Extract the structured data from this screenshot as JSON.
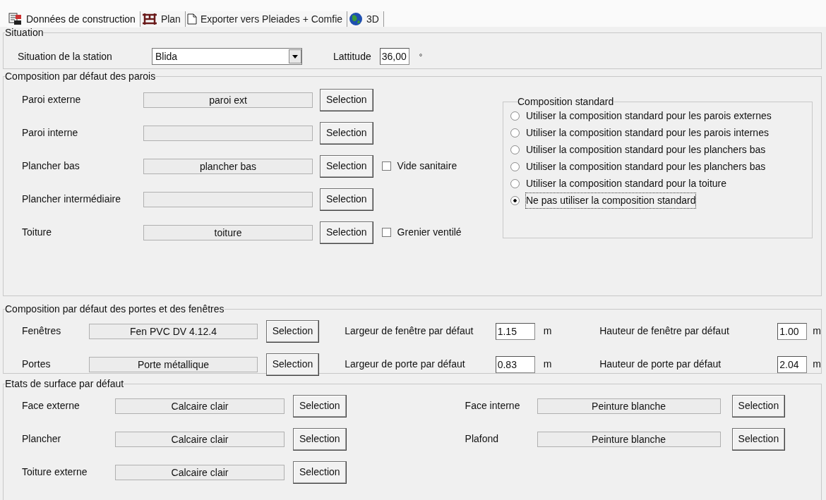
{
  "tabs": [
    {
      "label": "Données de construction",
      "selected": true
    },
    {
      "label": "Plan",
      "selected": false
    },
    {
      "label": "Exporter vers Pleiades + Comfie",
      "selected": false
    },
    {
      "label": "3D",
      "selected": false
    }
  ],
  "situation": {
    "legend": "Situation",
    "station_label": "Situation de la station",
    "station_value": "Blida",
    "latitude_label": "Lattitude",
    "latitude_value": "36,00",
    "latitude_unit": "°"
  },
  "walls": {
    "legend": "Composition par défaut des parois",
    "rows": [
      {
        "label": "Paroi externe",
        "value": "paroi ext",
        "button": "Selection"
      },
      {
        "label": "Paroi interne",
        "value": "",
        "button": "Selection"
      },
      {
        "label": "Plancher bas",
        "value": "plancher bas",
        "button": "Selection",
        "checkbox": {
          "label": "Vide sanitaire",
          "checked": false
        }
      },
      {
        "label": "Plancher intermédiaire",
        "value": "",
        "button": "Selection"
      },
      {
        "label": "Toiture",
        "value": "toiture",
        "button": "Selection",
        "checkbox": {
          "label": "Grenier ventilé",
          "checked": false
        }
      }
    ],
    "standard": {
      "legend": "Composition standard",
      "options": [
        {
          "label": "Utiliser la composition standard pour les parois externes",
          "selected": false
        },
        {
          "label": "Utiliser la composition standard pour les parois internes",
          "selected": false
        },
        {
          "label": "Utiliser la composition standard pour les planchers bas",
          "selected": false
        },
        {
          "label": "Utiliser la composition standard pour les planchers bas",
          "selected": false
        },
        {
          "label": "Utiliser la composition standard pour la toiture",
          "selected": false
        },
        {
          "label": "Ne pas utiliser la composition standard",
          "selected": true
        }
      ]
    }
  },
  "openings": {
    "legend": "Composition par défaut des portes et des fenêtres",
    "rows": [
      {
        "label": "Fenêtres",
        "value": "Fen PVC DV 4.12.4",
        "button": "Selection",
        "width_label": "Largeur de fenêtre par défaut",
        "width_value": "1.15",
        "width_unit": "m",
        "height_label": "Hauteur de fenêtre par défaut",
        "height_value": "1.00",
        "height_unit": "m"
      },
      {
        "label": "Portes",
        "value": "Porte métallique",
        "button": "Selection",
        "width_label": "Largeur de porte par défaut",
        "width_value": "0.83",
        "width_unit": "m",
        "height_label": "Hauteur de porte par défaut",
        "height_value": "2.04",
        "height_unit": "m"
      }
    ]
  },
  "surfaces": {
    "legend": "Etats de surface par défaut",
    "left": [
      {
        "label": "Face externe",
        "value": "Calcaire clair",
        "button": "Selection"
      },
      {
        "label": "Plancher",
        "value": "Calcaire clair",
        "button": "Selection"
      },
      {
        "label": "Toiture externe",
        "value": "Calcaire clair",
        "button": "Selection"
      }
    ],
    "right": [
      {
        "label": "Face interne",
        "value": "Peinture blanche",
        "button": "Selection"
      },
      {
        "label": "Plafond",
        "value": "Peinture blanche",
        "button": "Selection"
      }
    ]
  }
}
